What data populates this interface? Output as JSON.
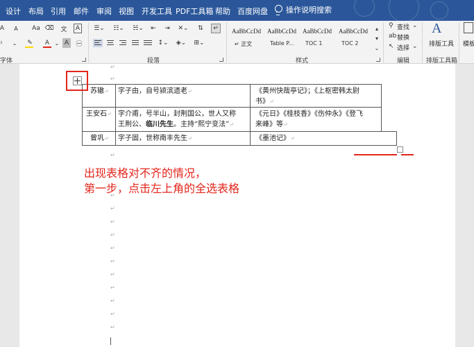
{
  "tabs": [
    "设计",
    "布局",
    "引用",
    "邮件",
    "审阅",
    "视图",
    "开发工具",
    "PDF工具箱",
    "帮助",
    "百度网盘"
  ],
  "search": {
    "label": "操作说明搜索",
    "icon": "lightbulb-icon"
  },
  "ribbon": {
    "font_partial_label": "字体",
    "paragraph_label": "段落",
    "styles_label": "样式",
    "editing_label": "编辑",
    "typeset_label": "排版工具箱",
    "font_buttons": [
      "A",
      "A",
      "Aa",
      "A",
      "A"
    ],
    "styles": [
      {
        "sample": "AaBbCcDd",
        "name": "↵ 正文"
      },
      {
        "sample": "AaBbCcDd",
        "name": "Table P..."
      },
      {
        "sample": "AaBbCcDd",
        "name": "TOC 1"
      },
      {
        "sample": "AaBbCcDd",
        "name": "TOC 2"
      }
    ],
    "editing": {
      "find": "查找",
      "replace": "替换",
      "select": "选择"
    },
    "typeset_button": "排版工具",
    "template_partial": "模板"
  },
  "colors": {
    "title_bar": "#2b579a",
    "annotation": "#e3251b",
    "highlight_yellow": "#ffd700",
    "font_red": "#e3251b"
  },
  "table": {
    "rows": [
      {
        "name": "苏辙",
        "desc": [
          "字子由，自号颍滨遗老"
        ],
        "works": [
          "《黄州快哉亭记》；《上枢密韩太尉",
          "书》"
        ]
      },
      {
        "name": "王安石",
        "desc": [
          "字介甫，号半山，封荆国公，世人又称",
          "王荆公、",
          "临川先生",
          "。主持“熙宁变法”"
        ],
        "works": [
          "《元日》《桂枝香》《伤仲永》《登飞",
          "来峰》等"
        ]
      },
      {
        "name": "曾巩",
        "desc": [
          "字子固，世称南丰先生"
        ],
        "works": [
          "《墨池记》"
        ]
      }
    ]
  },
  "annotation": {
    "line1": "出现表格对不齐的情况，",
    "line2": "第一步，点击左上角的全选表格"
  },
  "paragraph_mark": "↵"
}
